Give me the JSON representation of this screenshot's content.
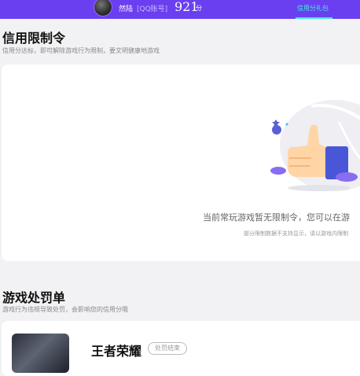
{
  "header": {
    "nickname": "然陆",
    "account_type": "[QQ账号]",
    "credit_score": "921",
    "score_unit": "分",
    "gift_link": "信用分礼包"
  },
  "restriction": {
    "title": "信用限制令",
    "subtitle": "信用分达标，即可解除游戏行为限制，要文明健康地游戏",
    "empty_text": "当前常玩游戏暂无限制令，您可以在游",
    "empty_note": "部分限制数据不支持显示，请以游戏内限制"
  },
  "penalty": {
    "title": "游戏处罚单",
    "subtitle": "游戏行为违规导致处罚，会影响您的信用分哦",
    "items": [
      {
        "game": "王者荣耀",
        "status": "处罚结束"
      }
    ]
  },
  "colors": {
    "header_bg": "#6a3ff0",
    "accent": "#45e8e3"
  }
}
